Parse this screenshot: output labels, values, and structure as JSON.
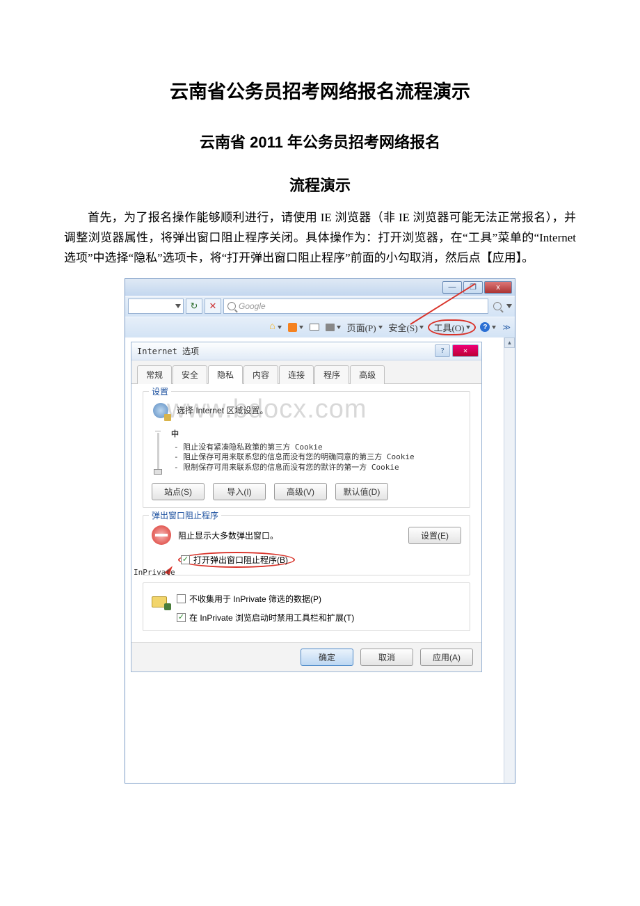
{
  "doc": {
    "title_main": "云南省公务员招考网络报名流程演示",
    "title_sub": "云南省 2011 年公务员招考网络报名",
    "title_sub2": "流程演示",
    "para1_a": "首先，为了报名操作能够顺利进行，请使用 ",
    "para1_ie": "IE",
    "para1_b": " 浏览器（非 ",
    "para1_c": " 浏览器可能无法正常报名），并调整浏览器属性，将弹出窗口阻止程序关闭。具体操作为：打开浏览器，在“工具”菜单的“",
    "para1_internet": "Internet",
    "para1_d": " 选项”中选择“隐私”选项卡，将“打开弹出窗口阻止程序”前面的小勾取消，然后点【应用】。"
  },
  "ie": {
    "titlebar": {
      "min": "—",
      "max": "❐",
      "close": "x"
    },
    "addr": {
      "refresh": "↻",
      "stop": "✕"
    },
    "search_placeholder": "Google",
    "toolbar": {
      "page": "页面(P)",
      "safety": "安全(S)",
      "tools": "工具(O)",
      "chev": "≫"
    }
  },
  "dlg": {
    "title": "Internet 选项",
    "help": "?",
    "close": "✕",
    "tabs": {
      "t1": "常规",
      "t2": "安全",
      "t3": "隐私",
      "t4": "内容",
      "t5": "连接",
      "t6": "程序",
      "t7": "高级"
    },
    "settings": {
      "label": "设置",
      "desc": "选择 Internet 区域设置。",
      "medium": "中",
      "b1": "- 阻止没有紧凑隐私政策的第三方 Cookie",
      "b2": "- 阻止保存可用来联系您的信息而没有您的明确同意的第三方 Cookie",
      "b3": "- 限制保存可用来联系您的信息而没有您的默许的第一方 Cookie",
      "btn_sites": "站点(S)",
      "btn_import": "导入(I)",
      "btn_adv": "高级(V)",
      "btn_default": "默认值(D)"
    },
    "popup": {
      "label": "弹出窗口阻止程序",
      "desc": "阻止显示大多数弹出窗口。",
      "btn_settings": "设置(E)",
      "chk": "打开弹出窗口阻止程序(B)"
    },
    "inprivate": {
      "label": "InPrivate",
      "chk1": "不收集用于 InPrivate 筛选的数据(P)",
      "chk2": "在 InPrivate 浏览启动时禁用工具栏和扩展(T)"
    },
    "footer": {
      "ok": "确定",
      "cancel": "取消",
      "apply": "应用(A)"
    }
  },
  "watermark": "www.bdocx.com"
}
